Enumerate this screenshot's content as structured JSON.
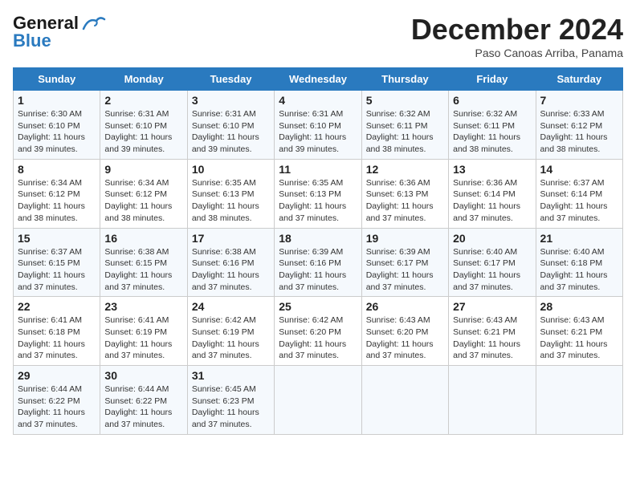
{
  "logo": {
    "line1": "General",
    "line2": "Blue"
  },
  "title": "December 2024",
  "subtitle": "Paso Canoas Arriba, Panama",
  "days_of_week": [
    "Sunday",
    "Monday",
    "Tuesday",
    "Wednesday",
    "Thursday",
    "Friday",
    "Saturday"
  ],
  "weeks": [
    [
      {
        "day": 1,
        "info": "Sunrise: 6:30 AM\nSunset: 6:10 PM\nDaylight: 11 hours\nand 39 minutes."
      },
      {
        "day": 2,
        "info": "Sunrise: 6:31 AM\nSunset: 6:10 PM\nDaylight: 11 hours\nand 39 minutes."
      },
      {
        "day": 3,
        "info": "Sunrise: 6:31 AM\nSunset: 6:10 PM\nDaylight: 11 hours\nand 39 minutes."
      },
      {
        "day": 4,
        "info": "Sunrise: 6:31 AM\nSunset: 6:10 PM\nDaylight: 11 hours\nand 39 minutes."
      },
      {
        "day": 5,
        "info": "Sunrise: 6:32 AM\nSunset: 6:11 PM\nDaylight: 11 hours\nand 38 minutes."
      },
      {
        "day": 6,
        "info": "Sunrise: 6:32 AM\nSunset: 6:11 PM\nDaylight: 11 hours\nand 38 minutes."
      },
      {
        "day": 7,
        "info": "Sunrise: 6:33 AM\nSunset: 6:12 PM\nDaylight: 11 hours\nand 38 minutes."
      }
    ],
    [
      {
        "day": 8,
        "info": "Sunrise: 6:34 AM\nSunset: 6:12 PM\nDaylight: 11 hours\nand 38 minutes."
      },
      {
        "day": 9,
        "info": "Sunrise: 6:34 AM\nSunset: 6:12 PM\nDaylight: 11 hours\nand 38 minutes."
      },
      {
        "day": 10,
        "info": "Sunrise: 6:35 AM\nSunset: 6:13 PM\nDaylight: 11 hours\nand 38 minutes."
      },
      {
        "day": 11,
        "info": "Sunrise: 6:35 AM\nSunset: 6:13 PM\nDaylight: 11 hours\nand 37 minutes."
      },
      {
        "day": 12,
        "info": "Sunrise: 6:36 AM\nSunset: 6:13 PM\nDaylight: 11 hours\nand 37 minutes."
      },
      {
        "day": 13,
        "info": "Sunrise: 6:36 AM\nSunset: 6:14 PM\nDaylight: 11 hours\nand 37 minutes."
      },
      {
        "day": 14,
        "info": "Sunrise: 6:37 AM\nSunset: 6:14 PM\nDaylight: 11 hours\nand 37 minutes."
      }
    ],
    [
      {
        "day": 15,
        "info": "Sunrise: 6:37 AM\nSunset: 6:15 PM\nDaylight: 11 hours\nand 37 minutes."
      },
      {
        "day": 16,
        "info": "Sunrise: 6:38 AM\nSunset: 6:15 PM\nDaylight: 11 hours\nand 37 minutes."
      },
      {
        "day": 17,
        "info": "Sunrise: 6:38 AM\nSunset: 6:16 PM\nDaylight: 11 hours\nand 37 minutes."
      },
      {
        "day": 18,
        "info": "Sunrise: 6:39 AM\nSunset: 6:16 PM\nDaylight: 11 hours\nand 37 minutes."
      },
      {
        "day": 19,
        "info": "Sunrise: 6:39 AM\nSunset: 6:17 PM\nDaylight: 11 hours\nand 37 minutes."
      },
      {
        "day": 20,
        "info": "Sunrise: 6:40 AM\nSunset: 6:17 PM\nDaylight: 11 hours\nand 37 minutes."
      },
      {
        "day": 21,
        "info": "Sunrise: 6:40 AM\nSunset: 6:18 PM\nDaylight: 11 hours\nand 37 minutes."
      }
    ],
    [
      {
        "day": 22,
        "info": "Sunrise: 6:41 AM\nSunset: 6:18 PM\nDaylight: 11 hours\nand 37 minutes."
      },
      {
        "day": 23,
        "info": "Sunrise: 6:41 AM\nSunset: 6:19 PM\nDaylight: 11 hours\nand 37 minutes."
      },
      {
        "day": 24,
        "info": "Sunrise: 6:42 AM\nSunset: 6:19 PM\nDaylight: 11 hours\nand 37 minutes."
      },
      {
        "day": 25,
        "info": "Sunrise: 6:42 AM\nSunset: 6:20 PM\nDaylight: 11 hours\nand 37 minutes."
      },
      {
        "day": 26,
        "info": "Sunrise: 6:43 AM\nSunset: 6:20 PM\nDaylight: 11 hours\nand 37 minutes."
      },
      {
        "day": 27,
        "info": "Sunrise: 6:43 AM\nSunset: 6:21 PM\nDaylight: 11 hours\nand 37 minutes."
      },
      {
        "day": 28,
        "info": "Sunrise: 6:43 AM\nSunset: 6:21 PM\nDaylight: 11 hours\nand 37 minutes."
      }
    ],
    [
      {
        "day": 29,
        "info": "Sunrise: 6:44 AM\nSunset: 6:22 PM\nDaylight: 11 hours\nand 37 minutes."
      },
      {
        "day": 30,
        "info": "Sunrise: 6:44 AM\nSunset: 6:22 PM\nDaylight: 11 hours\nand 37 minutes."
      },
      {
        "day": 31,
        "info": "Sunrise: 6:45 AM\nSunset: 6:23 PM\nDaylight: 11 hours\nand 37 minutes."
      },
      null,
      null,
      null,
      null
    ]
  ]
}
